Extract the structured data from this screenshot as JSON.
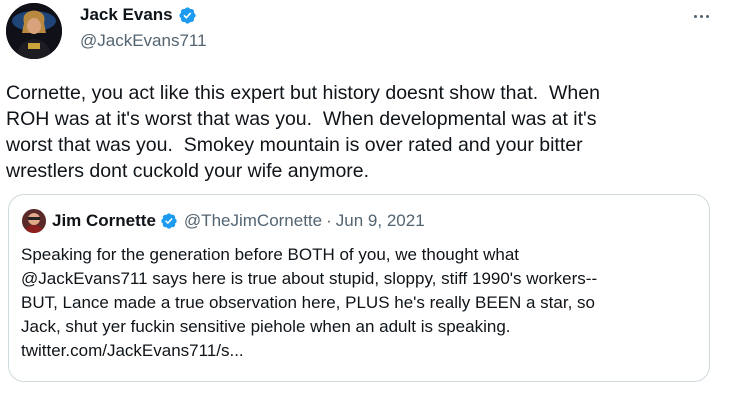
{
  "tweet": {
    "author_name": "Jack Evans",
    "author_handle": "@JackEvans711",
    "text": "Cornette, you act like this expert but history doesnt show that.  When\nROH was at it's worst that was you.  When developmental was at it's\nworst that was you.  Smokey mountain is over rated and your bitter\nwrestlers dont cuckold your wife anymore."
  },
  "quoted": {
    "author_name": "Jim Cornette",
    "author_handle": "@TheJimCornette",
    "separator": "·",
    "date": "Jun 9, 2021",
    "text": "Speaking for the generation before BOTH of you, we thought what\n@JackEvans711 says here is true about stupid, sloppy, stiff 1990's workers--\nBUT, Lance made a true observation here, PLUS he's really BEEN a star, so\nJack, shut yer fuckin sensitive piehole when an adult is speaking.\ntwitter.com/JackEvans711/s..."
  },
  "icons": {
    "verified": "verified-badge-icon",
    "more": "more-options-icon"
  },
  "colors": {
    "verified": "#1d9bf0",
    "secondary_text": "#536471",
    "border": "#cfd9de"
  }
}
